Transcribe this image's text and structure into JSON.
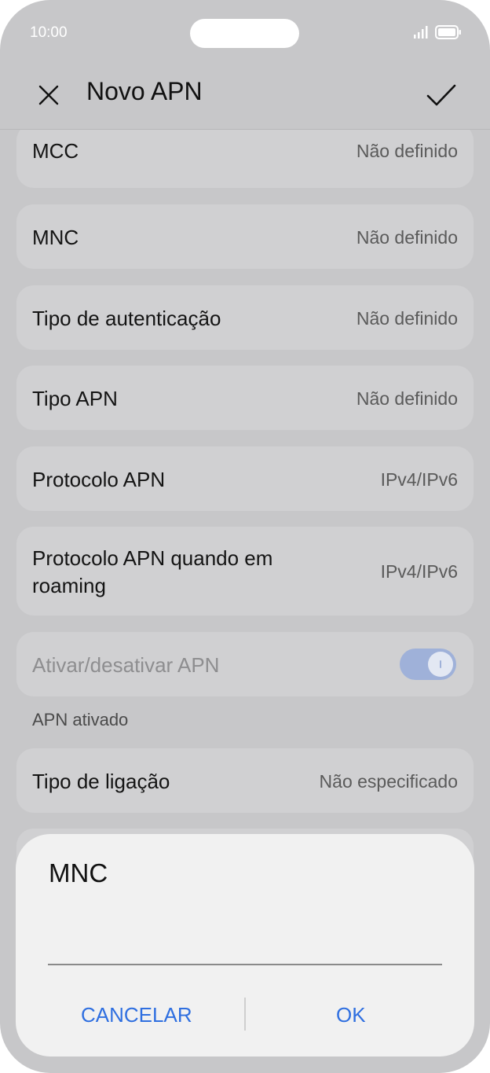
{
  "status_bar": {
    "time": "10:00"
  },
  "app_bar": {
    "title": "Novo APN",
    "close_icon": "close-icon",
    "confirm_icon": "check-icon"
  },
  "rows": [
    {
      "label": "MCC",
      "value": "Não definido"
    },
    {
      "label": "MNC",
      "value": "Não definido"
    },
    {
      "label": "Tipo de autenticação",
      "value": "Não definido"
    },
    {
      "label": "Tipo APN",
      "value": "Não definido"
    },
    {
      "label": "Protocolo APN",
      "value": "IPv4/IPv6"
    },
    {
      "label_line1": "Protocolo APN quando em",
      "label_line2": "roaming",
      "value": "IPv4/IPv6"
    }
  ],
  "apn_toggle": {
    "label": "Ativar/desativar APN",
    "on": true,
    "status_text": "APN ativado"
  },
  "connection_type": {
    "label": "Tipo de ligação",
    "value": "Não especificado"
  },
  "dialog": {
    "title": "MNC",
    "input_value": "",
    "cancel_label": "CANCELAR",
    "ok_label": "OK"
  },
  "colors": {
    "accent": "#2f6fe0",
    "background": "#c7c7c9",
    "card": "#d0d0d2",
    "dialog": "#f1f1f1"
  }
}
